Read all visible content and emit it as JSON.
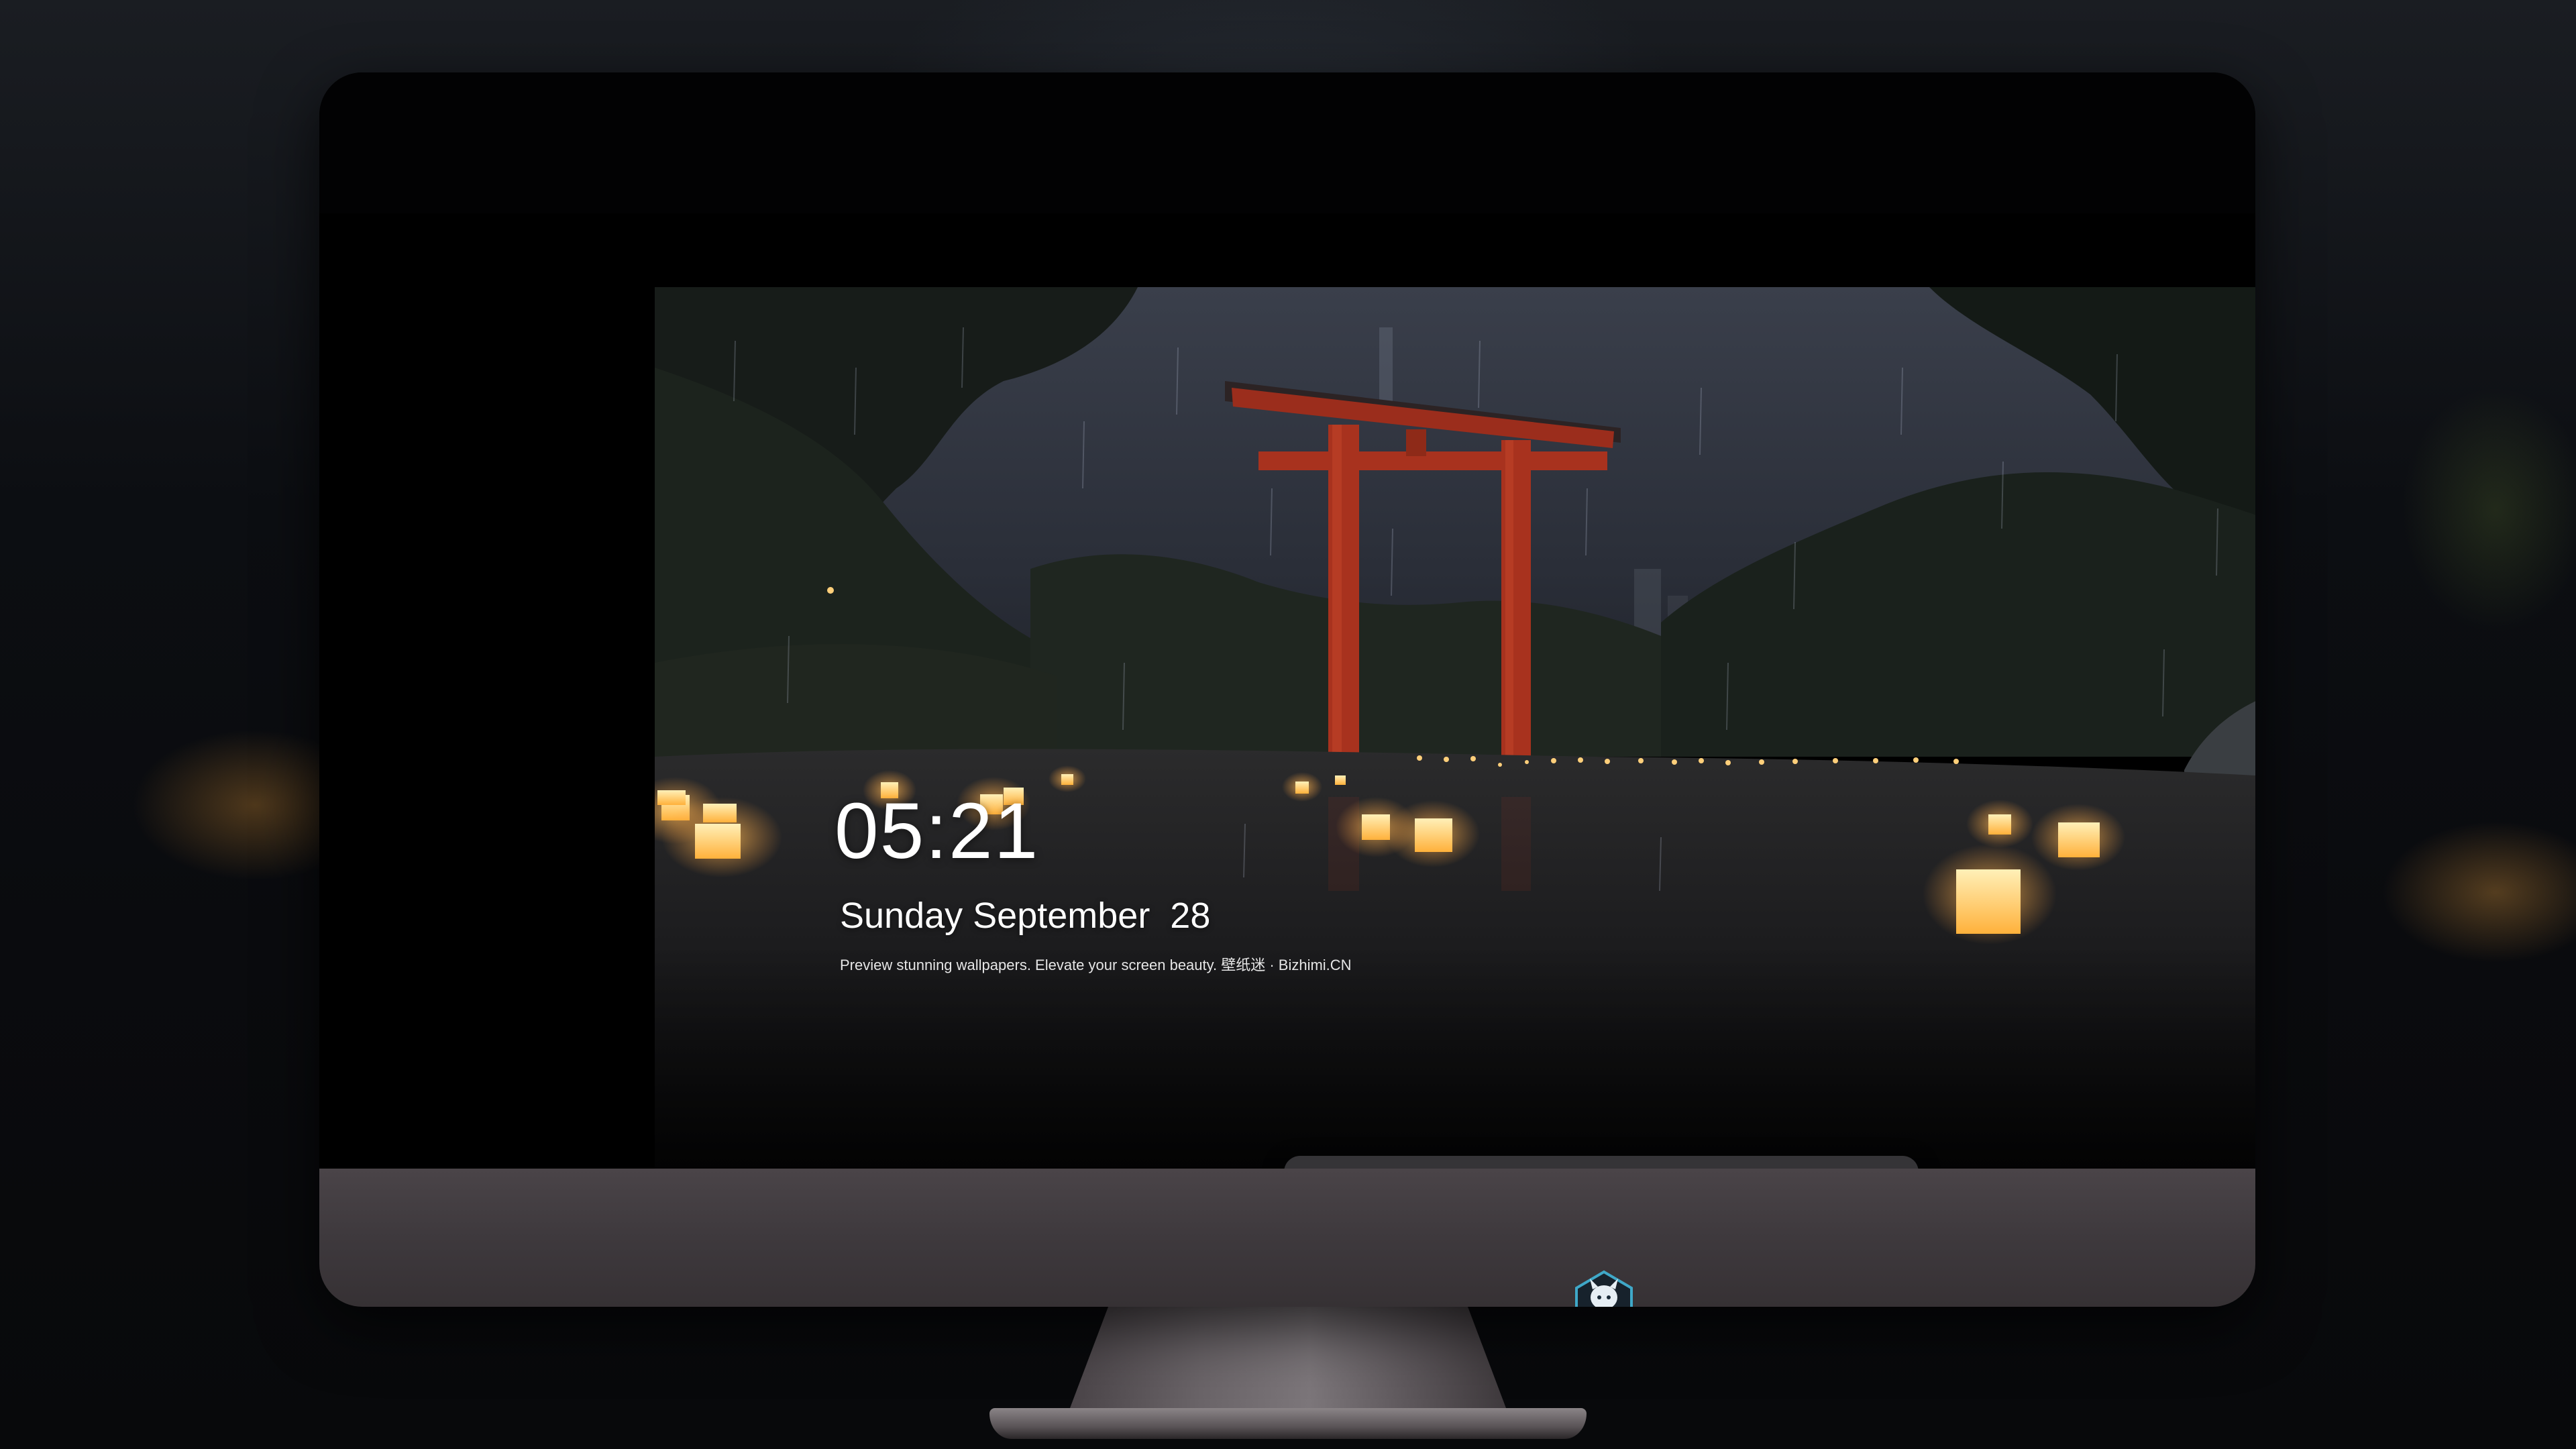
{
  "lock_screen": {
    "time": "05:21",
    "date": "Sunday September  28",
    "caption": "Preview stunning wallpapers. Elevate your screen beauty. 壁纸迷 · Bizhimi.CN"
  },
  "wallpaper": {
    "subject": "torii-gate-lantern-pond-rain",
    "colors": {
      "sky": "#2a2f3a",
      "torii": "#a8321e",
      "lantern": "#ffc766",
      "water": "#1a1a1c"
    }
  },
  "dock": {
    "apps": [
      {
        "id": "messages",
        "icon": "messages-icon",
        "color": "#34c759"
      },
      {
        "id": "weather",
        "icon": "weather-icon",
        "color": "#3a8ee8"
      },
      {
        "id": "clock",
        "icon": "clock-icon",
        "color": "#ffffff"
      },
      {
        "id": "preview",
        "icon": "preview-icon",
        "color": "#f2c94c"
      },
      {
        "id": "clips",
        "icon": "clapperboard-icon",
        "color": "#5ac8fa"
      },
      {
        "id": "notes",
        "icon": "notes-icon",
        "color": "#ffd54a"
      },
      {
        "id": "photos",
        "icon": "photo-gallery-icon",
        "color": "#ff9f0a"
      },
      {
        "id": "music",
        "icon": "music-note-icon",
        "color": "#e040fb"
      },
      {
        "id": "app-store",
        "icon": "app-store-icon",
        "color": "#1e88e5"
      },
      {
        "id": "camera",
        "icon": "camera-icon",
        "color": "#8e8e93"
      }
    ]
  },
  "hardware": {
    "chin_logo": "mascot-logo-icon"
  }
}
